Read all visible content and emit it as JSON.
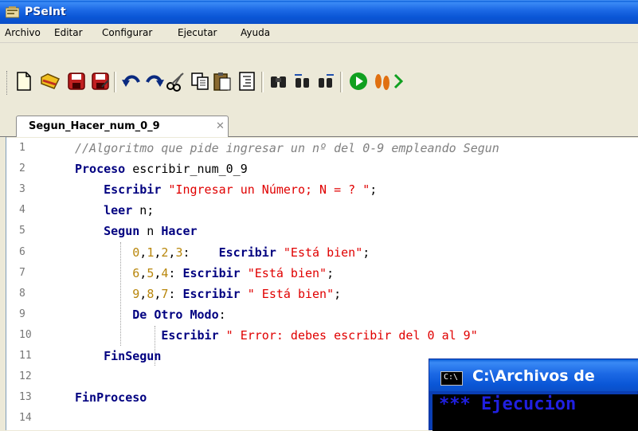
{
  "window": {
    "title": "PSeInt"
  },
  "menu": [
    "Archivo",
    "Editar",
    "Configurar",
    "Ejecutar",
    "Ayuda"
  ],
  "toolbar": {
    "icons": [
      "new-file-icon",
      "open-file-icon",
      "save-icon",
      "save-as-icon",
      "undo-icon",
      "redo-icon",
      "cut-icon",
      "copy-icon",
      "paste-icon",
      "indent-icon",
      "find-icon",
      "find-previous-icon",
      "find-next-icon",
      "run-icon",
      "step-by-step-icon",
      "flowchart-icon"
    ]
  },
  "tab": {
    "label": "Segun_Hacer_num_0_9",
    "close": "✕"
  },
  "editor": {
    "line_numbers": [
      "1",
      "2",
      "3",
      "4",
      "5",
      "6",
      "7",
      "8",
      "9",
      "10",
      "11",
      "12",
      "13",
      "14"
    ],
    "lines": [
      [
        {
          "t": "cm",
          "v": "//Algoritmo que pide ingresar un nº del 0-9 empleando Segun"
        }
      ],
      [
        {
          "t": "kw",
          "v": "Proceso"
        },
        {
          "t": "id",
          "v": " escribir_num_0_9"
        }
      ],
      [
        {
          "t": "id",
          "v": "    "
        },
        {
          "t": "kw",
          "v": "Escribir"
        },
        {
          "t": "id",
          "v": " "
        },
        {
          "t": "str",
          "v": "\"Ingresar un Número; N = ? \""
        },
        {
          "t": "id",
          "v": ";"
        }
      ],
      [
        {
          "t": "id",
          "v": "    "
        },
        {
          "t": "kw",
          "v": "leer"
        },
        {
          "t": "id",
          "v": " n;"
        }
      ],
      [
        {
          "t": "id",
          "v": "    "
        },
        {
          "t": "kw",
          "v": "Segun"
        },
        {
          "t": "id",
          "v": " n "
        },
        {
          "t": "kw",
          "v": "Hacer"
        }
      ],
      [
        {
          "t": "id",
          "v": "        "
        },
        {
          "t": "num",
          "v": "0"
        },
        {
          "t": "id",
          "v": ","
        },
        {
          "t": "num",
          "v": "1"
        },
        {
          "t": "id",
          "v": ","
        },
        {
          "t": "num",
          "v": "2"
        },
        {
          "t": "id",
          "v": ","
        },
        {
          "t": "num",
          "v": "3"
        },
        {
          "t": "id",
          "v": ":    "
        },
        {
          "t": "kw",
          "v": "Escribir"
        },
        {
          "t": "id",
          "v": " "
        },
        {
          "t": "str",
          "v": "\"Está bien\""
        },
        {
          "t": "id",
          "v": ";"
        }
      ],
      [
        {
          "t": "id",
          "v": "        "
        },
        {
          "t": "num",
          "v": "6"
        },
        {
          "t": "id",
          "v": ","
        },
        {
          "t": "num",
          "v": "5"
        },
        {
          "t": "id",
          "v": ","
        },
        {
          "t": "num",
          "v": "4"
        },
        {
          "t": "id",
          "v": ": "
        },
        {
          "t": "kw",
          "v": "Escribir"
        },
        {
          "t": "id",
          "v": " "
        },
        {
          "t": "str",
          "v": "\"Está bien\""
        },
        {
          "t": "id",
          "v": ";"
        }
      ],
      [
        {
          "t": "id",
          "v": "        "
        },
        {
          "t": "num",
          "v": "9"
        },
        {
          "t": "id",
          "v": ","
        },
        {
          "t": "num",
          "v": "8"
        },
        {
          "t": "id",
          "v": ","
        },
        {
          "t": "num",
          "v": "7"
        },
        {
          "t": "id",
          "v": ": "
        },
        {
          "t": "kw",
          "v": "Escribir"
        },
        {
          "t": "id",
          "v": " "
        },
        {
          "t": "str",
          "v": "\" Está bien\""
        },
        {
          "t": "id",
          "v": ";"
        }
      ],
      [
        {
          "t": "id",
          "v": "        "
        },
        {
          "t": "kw",
          "v": "De Otro Modo"
        },
        {
          "t": "id",
          "v": ":"
        }
      ],
      [
        {
          "t": "id",
          "v": "            "
        },
        {
          "t": "kw",
          "v": "Escribir"
        },
        {
          "t": "id",
          "v": " "
        },
        {
          "t": "str",
          "v": "\" Error: debes escribir del 0 al 9\""
        }
      ],
      [
        {
          "t": "id",
          "v": "    "
        },
        {
          "t": "kw",
          "v": "FinSegun"
        }
      ],
      [],
      [
        {
          "t": "kw",
          "v": "FinProceso"
        }
      ],
      []
    ]
  },
  "console": {
    "icon_label": "C:\\",
    "title": "C:\\Archivos de",
    "output": "*** Ejecucion"
  },
  "colors": {
    "keyword": "#000080",
    "string": "#e00000",
    "number": "#b8860b",
    "comment": "#808080",
    "titlebar": "#0a56d6"
  }
}
